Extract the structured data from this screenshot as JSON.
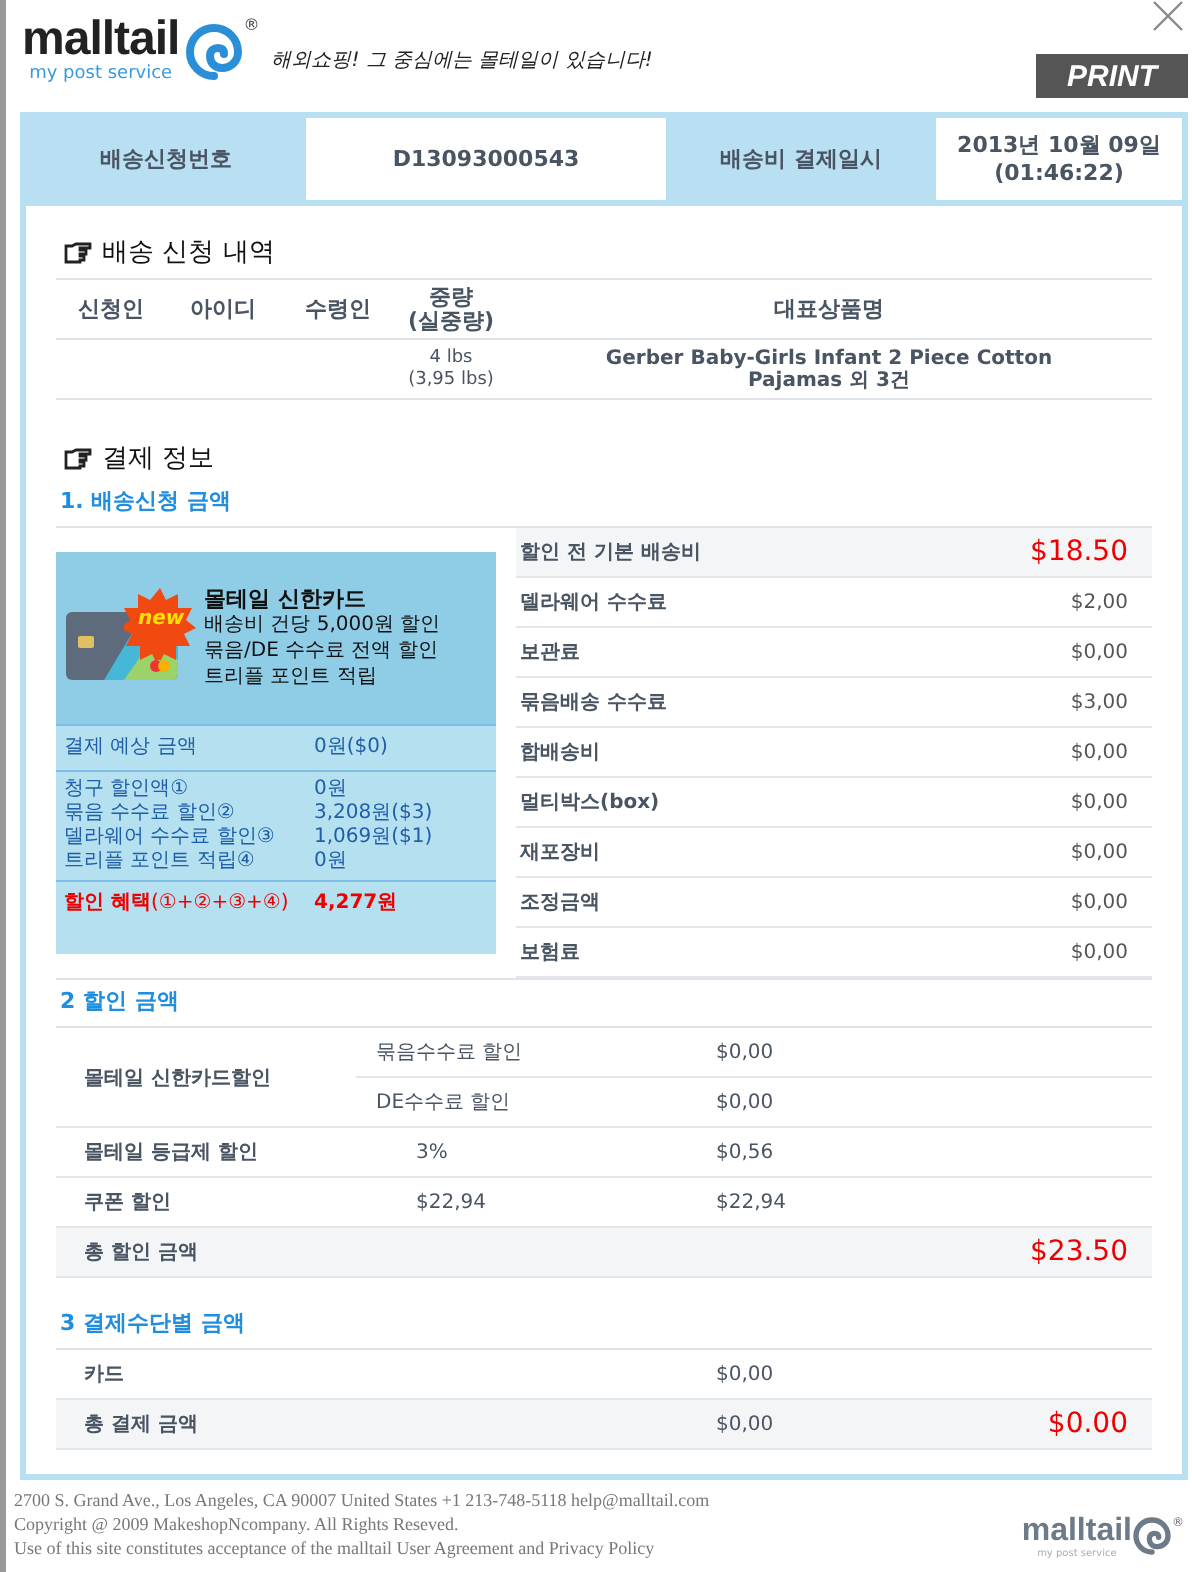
{
  "header": {
    "logo": {
      "name": "malltail",
      "registered": "®",
      "tagline": "my post service"
    },
    "slogan": "해외쇼핑! 그 중심에는 몰테일이 있습니다!",
    "print_button": "PRINT"
  },
  "summary": [
    {
      "label": "배송신청번호",
      "value": [
        "D13093000543"
      ]
    },
    {
      "label": "배송비 결제일시",
      "value": [
        "2013년 10월 09일",
        "(01:46:22)"
      ]
    }
  ],
  "request": {
    "title": "배송 신청 내역",
    "columns": [
      [
        "신청인"
      ],
      [
        "아이디"
      ],
      [
        "수령인"
      ],
      [
        "중량",
        "(실중량)"
      ],
      [
        "대표상품명"
      ]
    ],
    "row": {
      "weight": [
        "4 lbs",
        "(3,95 lbs)"
      ],
      "product": "Gerber Baby-Girls Infant 2 Piece Cotton Pajamas 외 3건"
    }
  },
  "payment": {
    "title": "결제 정보",
    "section1": {
      "title": "1. 배송신청 금액",
      "promo": {
        "badge": "new",
        "title": "몰테일 신한카드",
        "lines": [
          "배송비 건당 5,000원 할인",
          "묶음/DE 수수료 전액 할인",
          "트리플 포인트 적립"
        ]
      },
      "expected": {
        "label": "결제 예상 금액",
        "value": "0원($0)"
      },
      "discounts": [
        {
          "label": "청구 할인액①",
          "value": "0원"
        },
        {
          "label": "묶음 수수료 할인②",
          "value": "3,208원($3)"
        },
        {
          "label": "델라웨어 수수료 할인③",
          "value": "1,069원($1)"
        },
        {
          "label": "트리플 포인트 적립④",
          "value": "0원"
        }
      ],
      "benefit": {
        "label": "**할인 혜택**(①+②+③+④)",
        "value": "4,277원"
      },
      "fees": [
        {
          "kind": "total",
          "label": "할인 전 기본 배송비",
          "value": "$18.50"
        },
        {
          "kind": "item",
          "label": "델라웨어 수수료",
          "value": "$2,00"
        },
        {
          "kind": "item",
          "label": "보관료",
          "value": "$0,00"
        },
        {
          "kind": "item",
          "label": "묶음배송 수수료",
          "value": "$3,00"
        },
        {
          "kind": "item",
          "label": "합배송비",
          "value": "$0,00"
        },
        {
          "kind": "item",
          "label": "멀티박스(box)",
          "value": "$0,00"
        },
        {
          "kind": "item",
          "label": "재포장비",
          "value": "$0,00"
        },
        {
          "kind": "item",
          "label": "조정금액",
          "value": "$0,00"
        },
        {
          "kind": "item",
          "label": "보험료",
          "value": "$0,00"
        }
      ]
    },
    "section2": {
      "title": "2 할인 금액",
      "rows": [
        {
          "kind": "group",
          "label": "몰테일 신한카드할인",
          "items": [
            {
              "detail": "묶음수수료 할인",
              "amount": "$0,00"
            },
            {
              "detail": "DE수수료 할인",
              "amount": "$0,00"
            }
          ]
        },
        {
          "kind": "item",
          "label": "몰테일 등급제 할인",
          "detail": "3%",
          "amount": "$0,56"
        },
        {
          "kind": "item",
          "label": "쿠폰 할인",
          "detail": "$22,94",
          "amount": "$22,94"
        },
        {
          "kind": "total",
          "label": "총 할인 금액",
          "total": "$23.50"
        }
      ]
    },
    "section3": {
      "title": "3 결제수단별 금액",
      "rows": [
        {
          "kind": "item",
          "label": "카드",
          "amount": "$0,00"
        },
        {
          "kind": "total",
          "label": "총 결제 금액",
          "amount": "$0,00",
          "total": "$0.00"
        }
      ]
    }
  },
  "footer": {
    "lines": [
      "2700 S. Grand Ave., Los Angeles, CA 90007 United States +1 213-748-5118 help@malltail.com",
      "Copyright @ 2009 MakeshopNcompany. All Rights Reseved.",
      "Use of this site constitutes acceptance of the malltail User Agreement and Privacy Policy"
    ],
    "logo": {
      "name": "malltail",
      "registered": "®",
      "tagline": "my post service"
    }
  }
}
